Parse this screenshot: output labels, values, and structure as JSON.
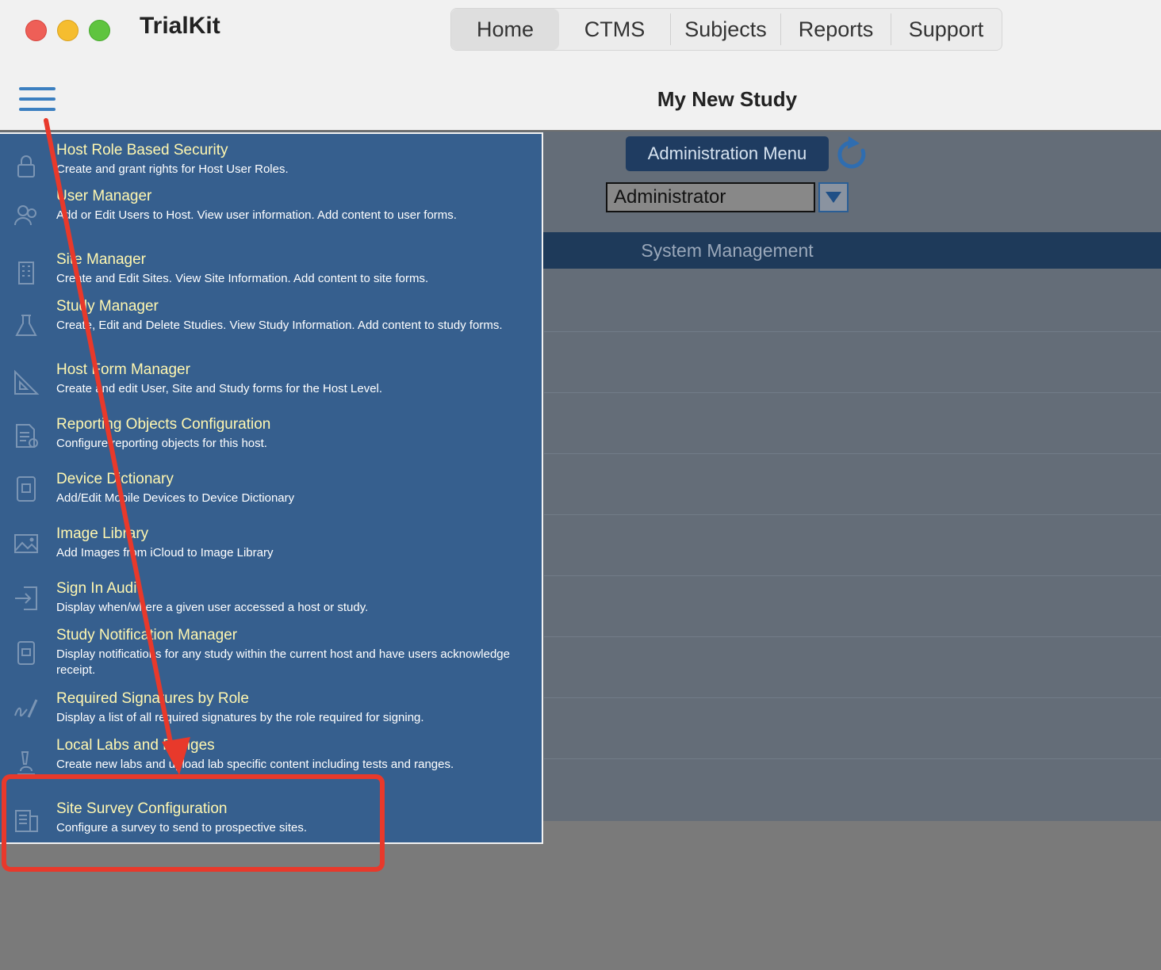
{
  "window": {
    "app_title": "TrialKit",
    "page_title": "My New Study"
  },
  "tabs": [
    {
      "label": "Home",
      "active": true
    },
    {
      "label": "CTMS",
      "active": false
    },
    {
      "label": "Subjects",
      "active": false
    },
    {
      "label": "Reports",
      "active": false
    },
    {
      "label": "Support",
      "active": false
    }
  ],
  "content": {
    "admin_menu_label": "Administration Menu",
    "role_value": "Administrator",
    "section_label": "System Management"
  },
  "menu": {
    "items": [
      {
        "title": "Host Role Based Security",
        "desc": "Create and grant rights for Host User Roles.",
        "icon": "lock-icon"
      },
      {
        "title": "User Manager",
        "desc": "Add or Edit Users to Host. View user information. Add content to user forms.",
        "icon": "users-icon"
      },
      {
        "title": "Site Manager",
        "desc": "Create and Edit Sites. View Site Information. Add content to site forms.",
        "icon": "building-icon"
      },
      {
        "title": "Study Manager",
        "desc": "Create, Edit and Delete Studies. View Study Information. Add content to study forms.",
        "icon": "flask-icon"
      },
      {
        "title": "Host Form Manager",
        "desc": "Create and edit User, Site and Study forms for the Host Level.",
        "icon": "ruler-icon"
      },
      {
        "title": "Reporting Objects Configuration",
        "desc": "Configure reporting objects for this host.",
        "icon": "report-icon"
      },
      {
        "title": "Device Dictionary",
        "desc": "Add/Edit Mobile Devices to Device Dictionary",
        "icon": "device-icon"
      },
      {
        "title": "Image Library",
        "desc": "Add Images from iCloud to Image Library",
        "icon": "image-icon"
      },
      {
        "title": "Sign In Audit",
        "desc": "Display when/where a given user accessed a host or study.",
        "icon": "sign-in-icon"
      },
      {
        "title": "Study Notification Manager",
        "desc": "Display notifications for any study within the current host and have users acknowledge receipt.",
        "icon": "notification-icon"
      },
      {
        "title": "Required Signatures by Role",
        "desc": "Display a list of all required signatures by the role required for signing.",
        "icon": "signature-icon"
      },
      {
        "title": "Local Labs and Ranges",
        "desc": "Create new labs and upload lab specific content including tests and ranges.",
        "icon": "microscope-icon"
      },
      {
        "title": "Site Survey Configuration",
        "desc": "Configure a survey to send to prospective sites.",
        "icon": "survey-icon"
      }
    ]
  },
  "colors": {
    "menu_bg": "#365f8e",
    "menu_title": "#fff7b0",
    "annotation": "#e8392b",
    "admin_button": "#1f3c61"
  }
}
